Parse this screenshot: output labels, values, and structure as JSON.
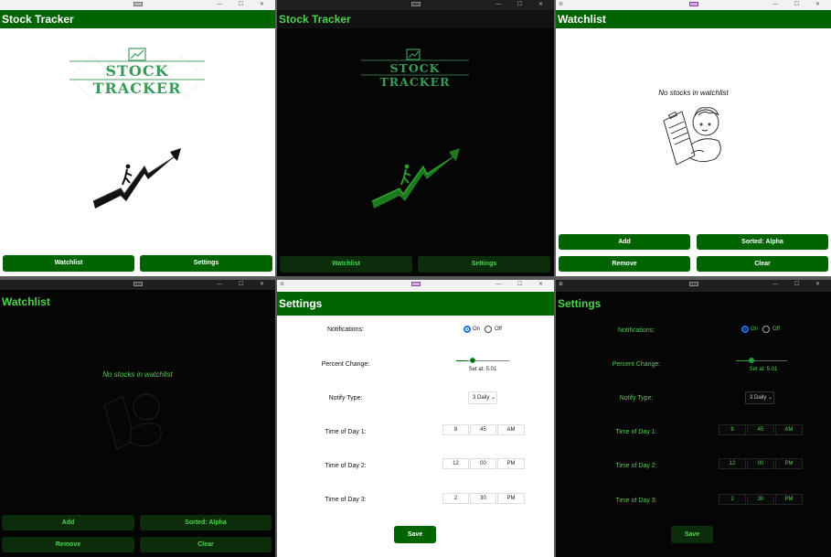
{
  "window_controls": "— ☐ ✕",
  "panel1": {
    "title": "Stock Tracker",
    "logo_text": "STOCK TRACKER",
    "buttons": {
      "watchlist": "Watchlist",
      "settings": "Settings"
    }
  },
  "panel2": {
    "title": "Stock Tracker",
    "logo_text": "STOCK TRACKER",
    "buttons": {
      "watchlist": "Watchlist",
      "settings": "Settings"
    }
  },
  "panel3": {
    "title": "Watchlist",
    "empty_text": "No stocks in watchlist",
    "buttons": {
      "add": "Add",
      "sorted": "Sorted: Alpha",
      "remove": "Remove",
      "clear": "Clear"
    }
  },
  "panel4": {
    "title": "Watchlist",
    "empty_text": "No stocks in watchlist",
    "buttons": {
      "add": "Add",
      "sorted": "Sorted: Alpha",
      "remove": "Remove",
      "clear": "Clear"
    }
  },
  "panel5": {
    "title": "Settings",
    "labels": {
      "notifications": "Notifications:",
      "percent_change": "Percent Change:",
      "notify_type": "Notify Type:",
      "time1": "Time of Day 1:",
      "time2": "Time of Day 2:",
      "time3": "Time of Day 3:"
    },
    "radio": {
      "on": "On",
      "off": "Off",
      "selected": "On"
    },
    "slider": {
      "value_text": "Set at:  5.01",
      "level": 0.2
    },
    "notify_type_value": "3 Daily",
    "times": [
      [
        "8",
        "45",
        "AM"
      ],
      [
        "12",
        "00",
        "PM"
      ],
      [
        "2",
        "30",
        "PM"
      ]
    ],
    "save": "Save"
  },
  "panel6": {
    "title": "Settings",
    "labels": {
      "notifications": "Notifications:",
      "percent_change": "Percent Change:",
      "notify_type": "Notify Type:",
      "time1": "Time of Day 1:",
      "time2": "Time of Day 2:",
      "time3": "Time of Day 3:"
    },
    "radio": {
      "on": "On",
      "off": "Off",
      "selected": "On"
    },
    "slider": {
      "value_text": "Set at:  5.01",
      "level": 0.3
    },
    "notify_type_value": "3 Daily",
    "times": [
      [
        "8",
        "45",
        "AM"
      ],
      [
        "12",
        "00",
        "PM"
      ],
      [
        "2",
        "30",
        "PM"
      ]
    ],
    "save": "Save"
  },
  "colors": {
    "brand_green": "#006400",
    "dark_accent": "#4cd44c",
    "dark_bg": "#050505"
  }
}
